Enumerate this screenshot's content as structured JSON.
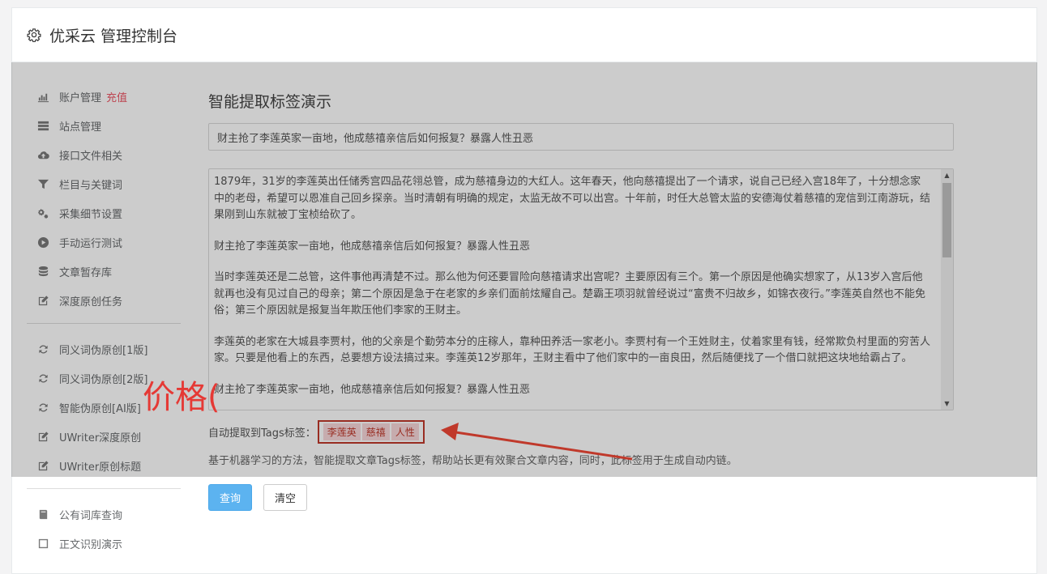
{
  "header": {
    "title": "优采云 管理控制台",
    "icon": "gear-icon"
  },
  "sidebar": {
    "items": [
      {
        "label": "账户管理",
        "extra": "充值",
        "icon": "bar-chart-icon"
      },
      {
        "label": "站点管理",
        "icon": "server-icon"
      },
      {
        "label": "接口文件相关",
        "icon": "cloud-upload-icon"
      },
      {
        "label": "栏目与关键词",
        "icon": "filter-icon"
      },
      {
        "label": "采集细节设置",
        "icon": "cogs-icon"
      },
      {
        "label": "手动运行测试",
        "icon": "play-circle-icon"
      },
      {
        "label": "文章暂存库",
        "icon": "database-icon"
      },
      {
        "label": "深度原创任务",
        "icon": "edit-icon"
      }
    ],
    "items2": [
      {
        "label": "同义词伪原创[1版]",
        "icon": "refresh-icon"
      },
      {
        "label": "同义词伪原创[2版]",
        "icon": "refresh-icon"
      },
      {
        "label": "智能伪原创[AI版]",
        "icon": "refresh-icon"
      },
      {
        "label": "UWriter深度原创",
        "icon": "edit-icon"
      },
      {
        "label": "UWriter原创标题",
        "icon": "edit-icon"
      }
    ],
    "items3": [
      {
        "label": "公有词库查询",
        "icon": "book-icon"
      },
      {
        "label": "正文识别演示",
        "icon": "square-icon"
      }
    ]
  },
  "main": {
    "heading": "智能提取标签演示",
    "title_value": "财主抢了李莲英家一亩地，他成慈禧亲信后如何报复？暴露人性丑恶",
    "content_paragraphs": [
      "1879年，31岁的李莲英出任储秀宫四品花翎总管，成为慈禧身边的大红人。这年春天，他向慈禧提出了一个请求，说自己已经入宫18年了，十分想念家中的老母，希望可以恩准自己回乡探亲。当时清朝有明确的规定，太监无故不可以出宫。十年前，时任大总管太监的安德海仗着慈禧的宠信到江南游玩，结果刚到山东就被丁宝桢给砍了。",
      "财主抢了李莲英家一亩地，他成慈禧亲信后如何报复？暴露人性丑恶",
      "当时李莲英还是二总管，这件事他再清楚不过。那么他为何还要冒险向慈禧请求出宫呢？主要原因有三个。第一个原因是他确实想家了，从13岁入宫后他就再也没有见过自己的母亲；第二个原因是急于在老家的乡亲们面前炫耀自己。楚霸王项羽就曾经说过“富贵不归故乡，如锦衣夜行。”李莲英自然也不能免俗；第三个原因就是报复当年欺压他们李家的王财主。",
      "李莲英的老家在大城县李贾村，他的父亲是个勤劳本分的庄稼人，靠种田养活一家老小。李贾村有一个王姓财主，仗着家里有钱，经常欺负村里面的穷苦人家。只要是他看上的东西，总要想方设法搞过来。李莲英12岁那年，王财主看中了他们家中的一亩良田，然后随便找了一个借口就把这块地给霸占了。",
      "财主抢了李莲英家一亩地，他成慈禧亲信后如何报复？暴露人性丑恶"
    ],
    "tags_label": "自动提取到Tags标签：",
    "tags": [
      "李莲英",
      "慈禧",
      "人性"
    ],
    "description": "基于机器学习的方法，智能提取文章Tags标签，帮助站长更有效聚合文章内容，同时，此标签用于生成自动内链。",
    "query_button": "查询",
    "clear_button": "清空"
  },
  "annotation": {
    "text": "价格(",
    "color": "#e53935"
  }
}
